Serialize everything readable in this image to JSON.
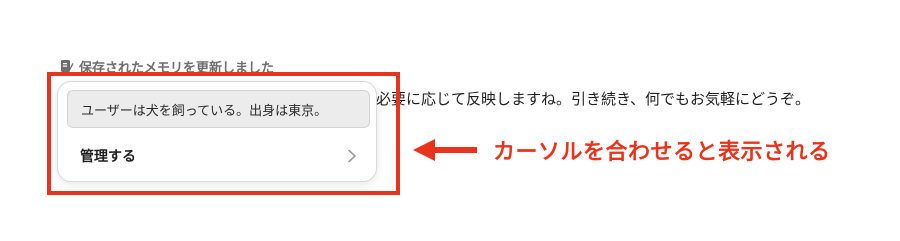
{
  "memory_notice": {
    "label": "保存されたメモリを更新しました",
    "icon": "memory-pencil-icon"
  },
  "assistant_message": {
    "text": "必要に応じて反映しますね。引き続き、何でもお気軽にどうぞ。"
  },
  "popover": {
    "memory_item": "ユーザーは犬を飼っている。出身は東京。",
    "manage_label": "管理する",
    "manage_icon": "chevron-right-icon"
  },
  "annotation": {
    "text": "カーソルを合わせると表示される",
    "color": "#e8341c",
    "arrow_icon": "arrow-left-icon"
  }
}
